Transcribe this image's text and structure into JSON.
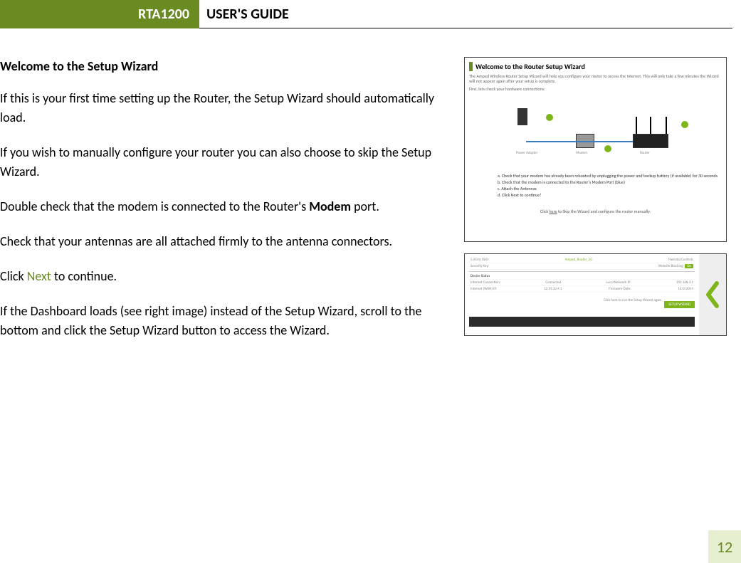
{
  "header": {
    "model": "RTA1200",
    "guide": "USER'S GUIDE"
  },
  "body": {
    "heading": "Welcome to the Setup Wizard",
    "p1": "If this is your first time setting up the Router, the Setup Wizard should automatically load.",
    "p2": "If you wish to manually configure your router you can also choose to skip the Setup Wizard.",
    "p3a": "Double check that the modem is connected to the Router's ",
    "p3b_bold": "Modem",
    "p3c": " port.",
    "p4": "Check that your antennas are all attached firmly to the antenna connectors.",
    "p5a": "Click ",
    "p5_next": "Next",
    "p5b": " to continue.",
    "p6": "If the Dashboard loads (see right image) instead of the Setup Wizard, scroll to the bottom and click the Setup Wizard button to access the Wizard."
  },
  "fig1": {
    "title": "Welcome to the Router Setup Wizard",
    "sub1": "The Amped Wireless Router Setup Wizard will help you configure your router to access the Internet. This will only take a few minutes the Wizard will not appear again after your setup is complete.",
    "sub2": "First, lets check your hardware connections:",
    "labels": {
      "adapter": "Power Adapter",
      "modem": "Modem",
      "router": "Router"
    },
    "steps": {
      "a": "a. Check that your modem has already been rebooted by unplugging the power and backup battery (if available) for 30 seconds",
      "b": "b. Check that the modem is connected to the Router's Modem Port (blue)",
      "c": "c. Attach the Antennas",
      "d": "d. Click Next to continue!"
    },
    "skip_a": "Click ",
    "skip_here": "here",
    "skip_b": " to Skip the Wizard and configure the router manually."
  },
  "fig2": {
    "rows": {
      "r1l": "5.0GHz SSID:",
      "r1lv": "Amped_Router_5G",
      "r1r": "Parental Controls",
      "r2l": "Security Key:",
      "r2r": "Website Blocking: ",
      "r2pill": "On",
      "r3l": "Device Status",
      "r4l": "Internet Connection:",
      "r4lv": "Connected",
      "r4r": "Local Network IP:",
      "r4rv": "192.168.3.1",
      "r5l": "Internet (WAN) IP:",
      "r5lv": "12.19.32.4.1",
      "r5r": "Firmware Date:",
      "r5rv": "12/2/2014"
    },
    "swbtn": "SETUP WIZARD",
    "swtxt": "Click here to run the Setup Wizard again"
  },
  "page_number": "12"
}
